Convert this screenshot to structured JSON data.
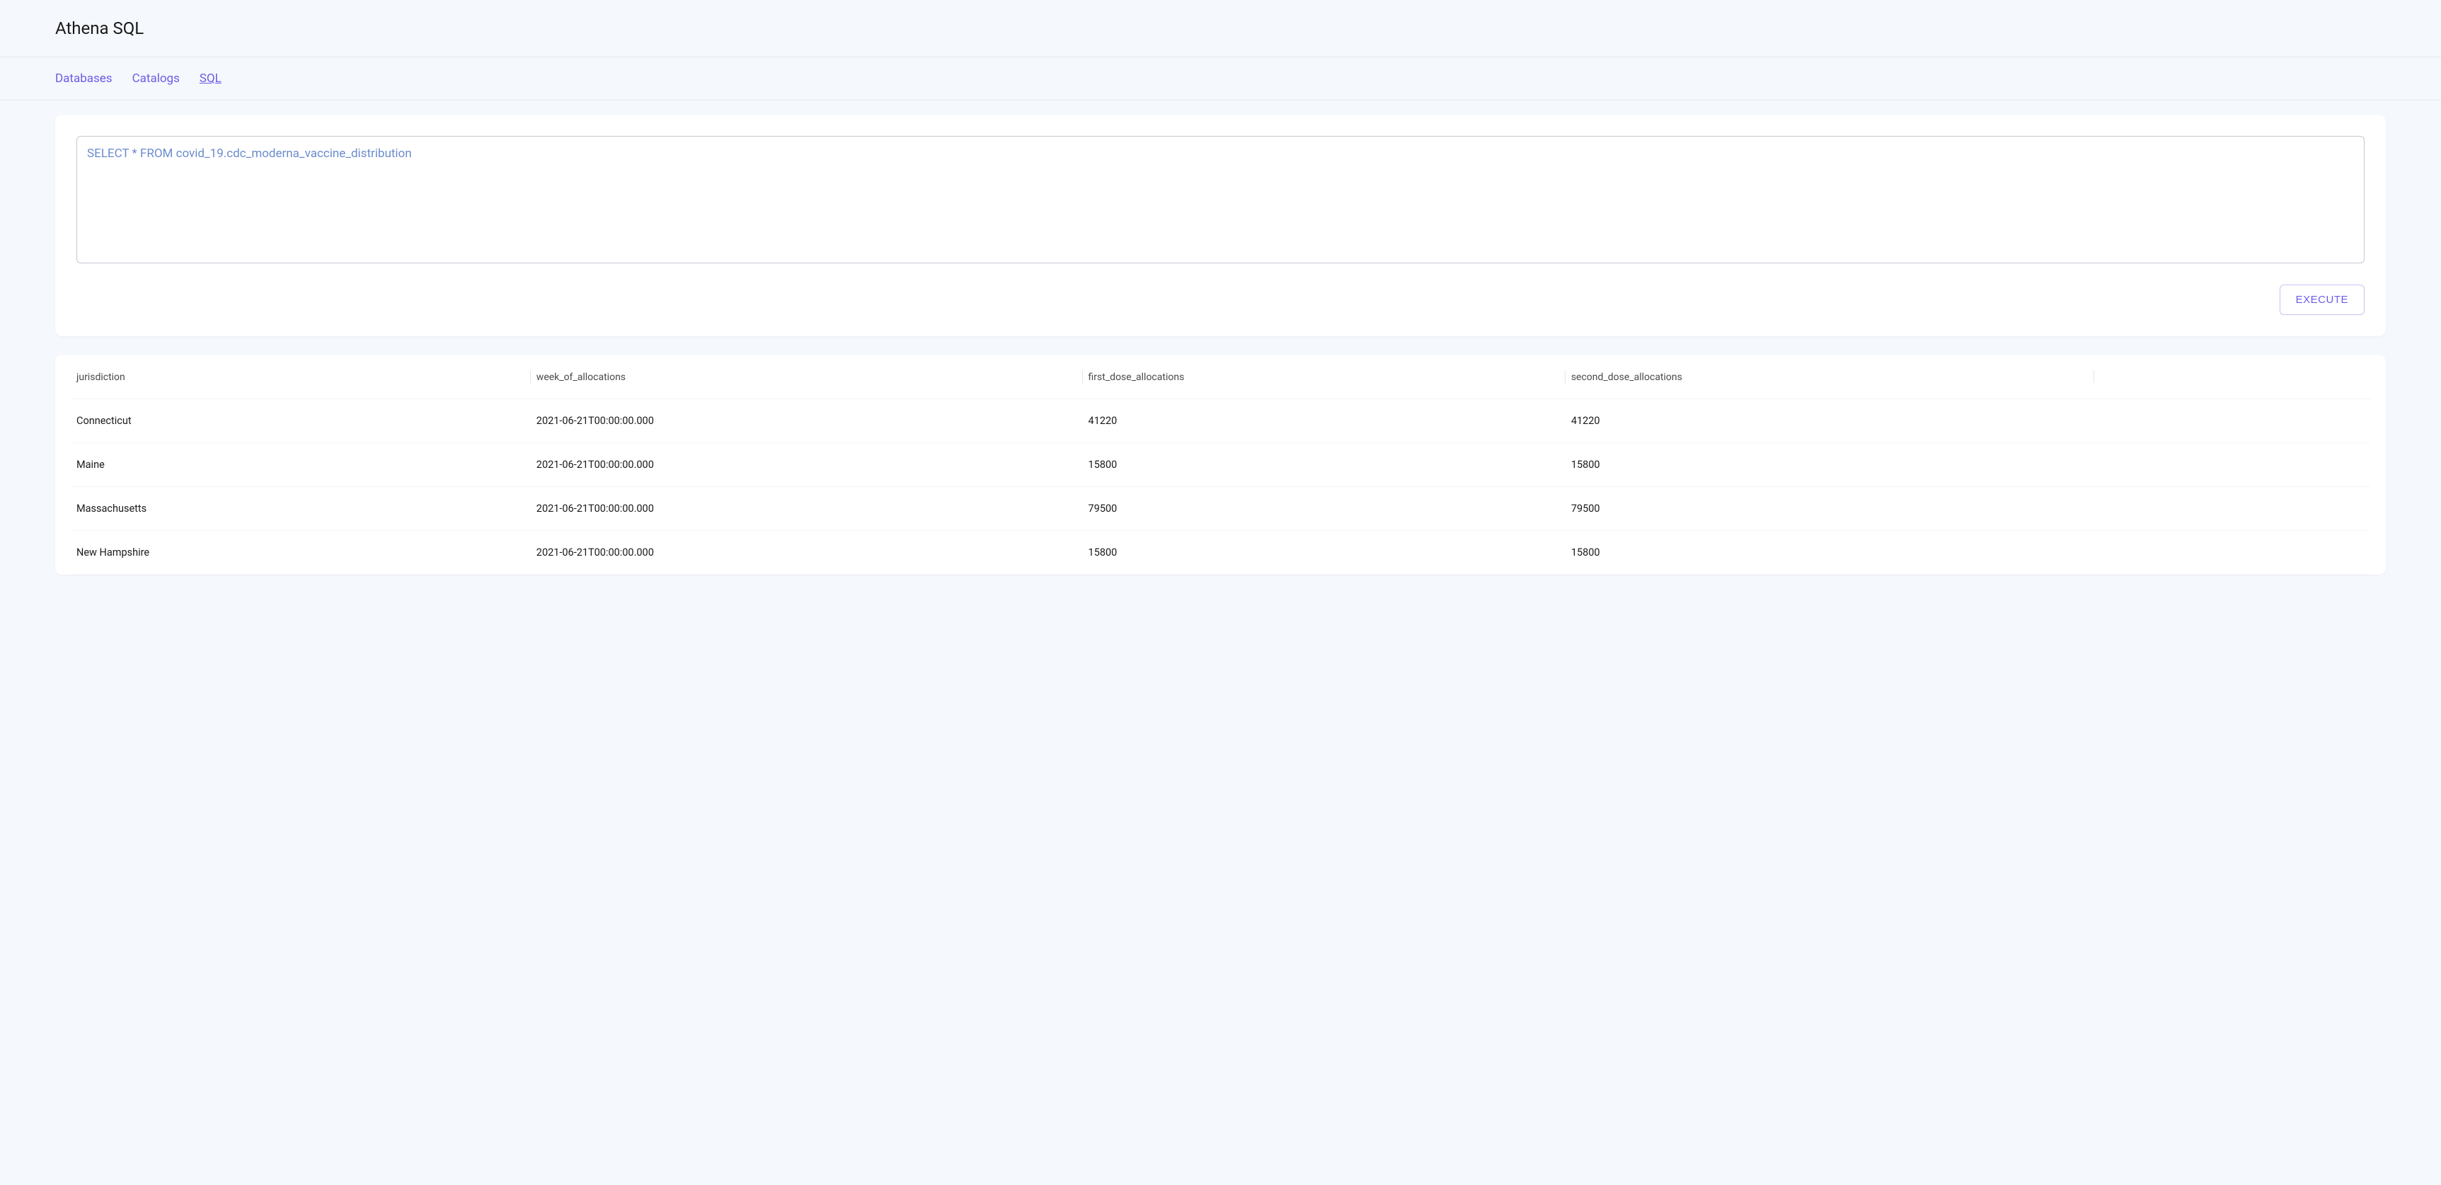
{
  "header": {
    "title": "Athena SQL"
  },
  "nav": {
    "items": [
      {
        "label": "Databases",
        "active": false
      },
      {
        "label": "Catalogs",
        "active": false
      },
      {
        "label": "SQL",
        "active": true
      }
    ]
  },
  "query": {
    "sql": "SELECT * FROM covid_19.cdc_moderna_vaccine_distribution",
    "execute_label": "EXECUTE"
  },
  "results": {
    "columns": [
      "jurisdiction",
      "week_of_allocations",
      "first_dose_allocations",
      "second_dose_allocations",
      ""
    ],
    "rows": [
      {
        "jurisdiction": "Connecticut",
        "week_of_allocations": "2021-06-21T00:00:00.000",
        "first_dose_allocations": "41220",
        "second_dose_allocations": "41220"
      },
      {
        "jurisdiction": "Maine",
        "week_of_allocations": "2021-06-21T00:00:00.000",
        "first_dose_allocations": "15800",
        "second_dose_allocations": "15800"
      },
      {
        "jurisdiction": "Massachusetts",
        "week_of_allocations": "2021-06-21T00:00:00.000",
        "first_dose_allocations": "79500",
        "second_dose_allocations": "79500"
      },
      {
        "jurisdiction": "New Hampshire",
        "week_of_allocations": "2021-06-21T00:00:00.000",
        "first_dose_allocations": "15800",
        "second_dose_allocations": "15800"
      }
    ]
  }
}
